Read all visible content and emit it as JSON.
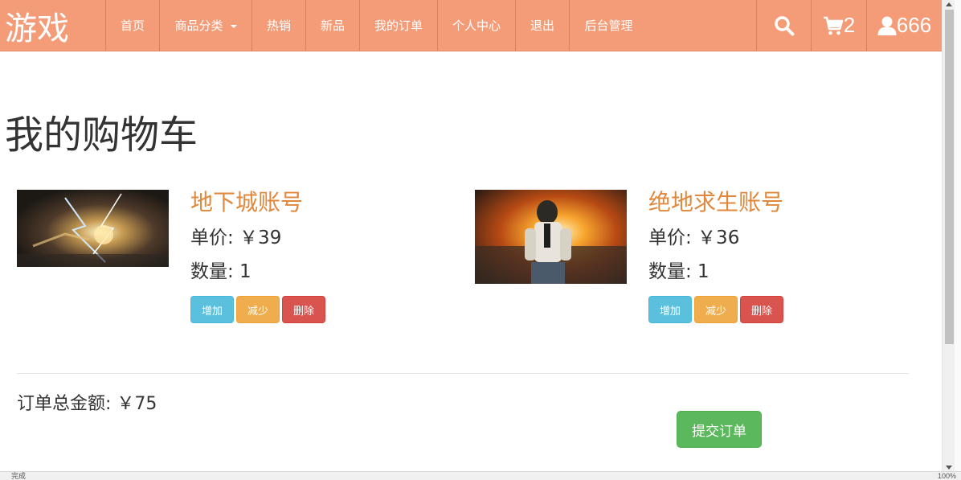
{
  "navbar": {
    "brand": "游戏",
    "items": [
      {
        "label": "首页"
      },
      {
        "label": "商品分类",
        "dropdown": true
      },
      {
        "label": "热销"
      },
      {
        "label": "新品"
      },
      {
        "label": "我的订单"
      },
      {
        "label": "个人中心"
      },
      {
        "label": "退出"
      },
      {
        "label": "后台管理"
      }
    ],
    "cart_count": "2",
    "user_name": "666",
    "background_color": "#f49c78"
  },
  "main": {
    "title": "我的购物车",
    "items": [
      {
        "name": "地下城账号",
        "price_label": "单价: ￥39",
        "quantity_label": "数量: 1",
        "buttons": {
          "increase": "增加",
          "decrease": "减少",
          "delete": "删除"
        }
      },
      {
        "name": "绝地求生账号",
        "price_label": "单价: ￥36",
        "quantity_label": "数量: 1",
        "buttons": {
          "increase": "增加",
          "decrease": "减少",
          "delete": "删除"
        }
      }
    ],
    "total_label": "订单总金额: ￥75",
    "submit_label": "提交订单"
  },
  "statusbar": {
    "text": "完成",
    "zoom": "100%"
  },
  "colors": {
    "accent_name": "#e0883c",
    "info": "#5bc0de",
    "warning": "#f0ad4e",
    "danger": "#d9534f",
    "success": "#5cb85c"
  },
  "icons": [
    "search-icon",
    "cart-icon",
    "user-icon",
    "chevron-down-icon"
  ]
}
